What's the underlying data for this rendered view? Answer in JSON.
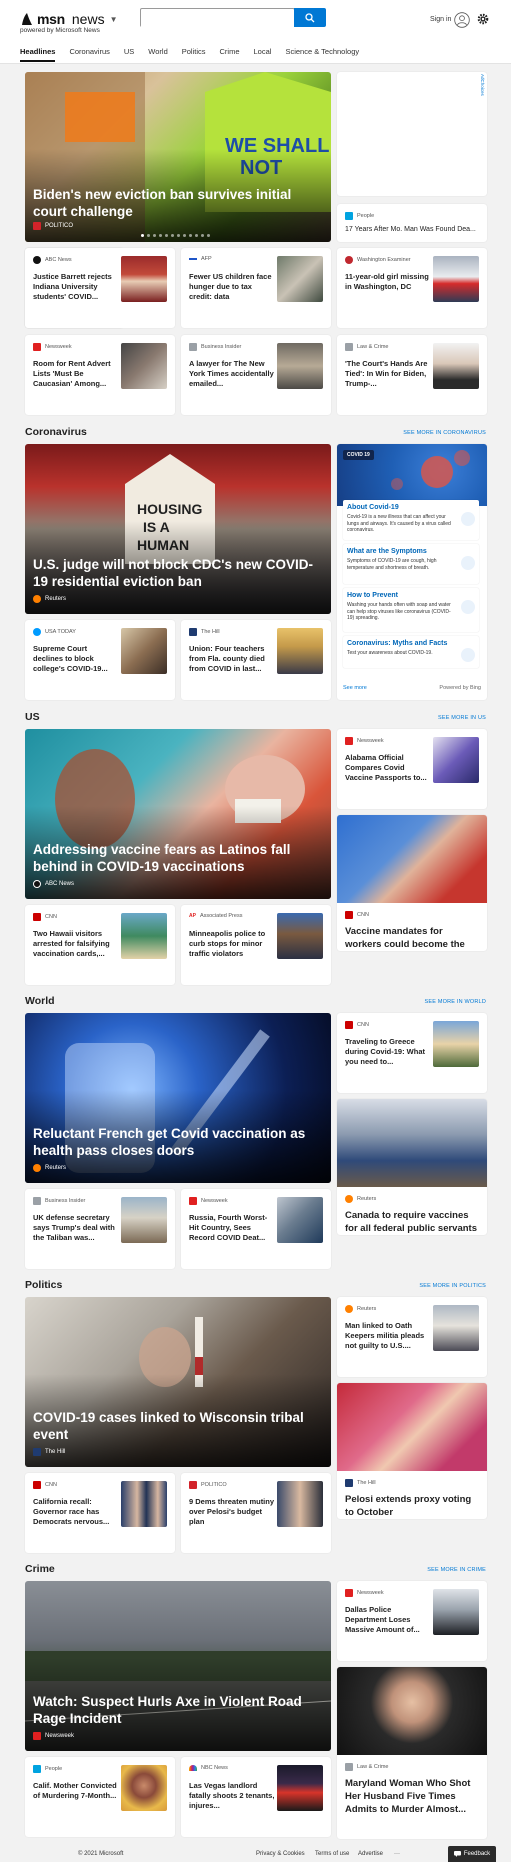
{
  "header": {
    "logo_msn": "msn",
    "logo_news": "news",
    "powered_by": "powered by Microsoft News",
    "search_placeholder": "",
    "signin": "Sign in"
  },
  "nav": [
    "Headlines",
    "Coronavirus",
    "US",
    "World",
    "Politics",
    "Crime",
    "Local",
    "Science & Technology"
  ],
  "ad_label": "AdChoices",
  "top": {
    "hero": {
      "title": "Biden's new eviction ban survives initial court challenge",
      "source": "POLITICO"
    },
    "side": {
      "source": "People",
      "title": "17 Years After Mo. Man Was Found Dea..."
    },
    "row1": [
      {
        "source": "ABC News",
        "title": "Justice Barrett rejects Indiana University students' COVID..."
      },
      {
        "source": "AFP",
        "title": "Fewer US children face hunger due to tax credit: data"
      },
      {
        "source": "Washington Examiner",
        "title": "11-year-old girl missing in Washington, DC"
      }
    ],
    "row2": [
      {
        "source": "Newsweek",
        "title": "Room for Rent Advert Lists 'Must Be Caucasian' Among..."
      },
      {
        "source": "Business Insider",
        "title": "A lawyer for The New York Times accidentally emailed..."
      },
      {
        "source": "Law & Crime",
        "title": "'The Court's Hands Are Tied': In Win for Biden, Trump-..."
      }
    ]
  },
  "coronavirus": {
    "heading": "Coronavirus",
    "see_more": "SEE MORE IN CORONAVIRUS",
    "hero": {
      "title": "U.S. judge will not block CDC's new COVID-19 residential eviction ban",
      "source": "Reuters"
    },
    "row": [
      {
        "source": "USA TODAY",
        "title": "Supreme Court declines to block college's COVID-19..."
      },
      {
        "source": "The Hill",
        "title": "Union: Four teachers from Fla. county died from COVID in last..."
      }
    ],
    "widget": {
      "tag": "COVID 19",
      "items": [
        {
          "title": "About Covid-19",
          "desc": "Covid-19 is a new illness that can affect your lungs and airways. It's caused by a virus called coronavirus."
        },
        {
          "title": "What are the Symptoms",
          "desc": "Symptoms of COVID-19 are cough, high temperature and shortness of breath."
        },
        {
          "title": "How to Prevent",
          "desc": "Washing your hands often with soap and water can help stop viruses like coronavirus (COVID-19) spreading."
        },
        {
          "title": "Coronavirus: Myths and Facts",
          "desc": "Test your awareness about COVID-19."
        }
      ],
      "see_more": "See more",
      "powered": "Powered by Bing"
    }
  },
  "us": {
    "heading": "US",
    "see_more": "SEE MORE IN US",
    "hero": {
      "title": "Addressing vaccine fears as Latinos fall behind in COVID-19 vaccinations",
      "source": "ABC News"
    },
    "side_small": {
      "source": "Newsweek",
      "title": "Alabama Official Compares Covid Vaccine Passports to..."
    },
    "side_tall": {
      "source": "CNN",
      "title": "Vaccine mandates for workers could become the new normal"
    },
    "row": [
      {
        "source": "CNN",
        "title": "Two Hawaii visitors arrested for falsifying vaccination cards,..."
      },
      {
        "source": "Associated Press",
        "title": "Minneapolis police to curb stops for minor traffic violators"
      }
    ]
  },
  "world": {
    "heading": "World",
    "see_more": "SEE MORE IN WORLD",
    "hero": {
      "title": "Reluctant French get Covid vaccination as health pass closes doors",
      "source": "Reuters"
    },
    "side_small": {
      "source": "CNN",
      "title": "Traveling to Greece during Covid-19: What you need to..."
    },
    "side_tall": {
      "source": "Reuters",
      "title": "Canada to require vaccines for all federal public servants"
    },
    "row": [
      {
        "source": "Business Insider",
        "title": "UK defense secretary says Trump's deal with the Taliban was..."
      },
      {
        "source": "Newsweek",
        "title": "Russia, Fourth Worst-Hit Country, Sees Record COVID Deat..."
      }
    ]
  },
  "politics": {
    "heading": "Politics",
    "see_more": "SEE MORE IN POLITICS",
    "hero": {
      "title": "COVID-19 cases linked to Wisconsin tribal event",
      "source": "The Hill"
    },
    "side_small": {
      "source": "Reuters",
      "title": "Man linked to Oath Keepers militia pleads not guilty to U.S...."
    },
    "side_tall": {
      "source": "The Hill",
      "title": "Pelosi extends proxy voting to October"
    },
    "row": [
      {
        "source": "CNN",
        "title": "California recall: Governor race has Democrats nervous..."
      },
      {
        "source": "POLITICO",
        "title": "9 Dems threaten mutiny over Pelosi's budget plan"
      }
    ]
  },
  "crime": {
    "heading": "Crime",
    "see_more": "SEE MORE IN CRIME",
    "hero": {
      "title": "Watch: Suspect Hurls Axe in Violent Road Rage Incident",
      "source": "Newsweek"
    },
    "side_small": {
      "source": "Newsweek",
      "title": "Dallas Police Department Loses Massive Amount of..."
    },
    "side_tall": {
      "source": "Law & Crime",
      "title": "Maryland Woman Who Shot Her Husband Five Times Admits to Murder Almost..."
    },
    "row": [
      {
        "source": "People",
        "title": "Calif. Mother Convicted of Murdering 7-Month..."
      },
      {
        "source": "NBC News",
        "title": "Las Vegas landlord fatally shoots 2 tenants, injures..."
      }
    ]
  },
  "footer": {
    "copyright": "© 2021 Microsoft",
    "privacy": "Privacy & Cookies",
    "terms": "Terms of use",
    "advertise": "Advertise",
    "more": "···",
    "feedback": "Feedback"
  },
  "colors": {
    "accent": "#0078d4",
    "politico": "#d2232a",
    "newsweek": "#e02020",
    "cnn": "#cc0000",
    "people": "#00a3e0",
    "reuters": "#ff8000",
    "thehill": "#1f3b70"
  }
}
